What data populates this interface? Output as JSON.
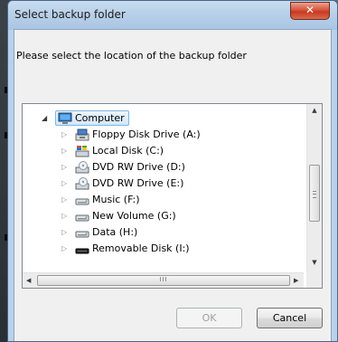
{
  "dialog": {
    "title": "Select backup folder",
    "close_glyph": "✕",
    "prompt": "Please select the location of the backup folder"
  },
  "tree": {
    "root": {
      "label": "Computer",
      "icon": "computer-icon",
      "expanded": true,
      "selected": true
    },
    "items": [
      {
        "label": "Floppy Disk Drive (A:)",
        "icon": "floppy-drive-icon"
      },
      {
        "label": "Local Disk (C:)",
        "icon": "system-disk-icon"
      },
      {
        "label": "DVD RW Drive (D:)",
        "icon": "dvd-drive-icon"
      },
      {
        "label": "DVD RW Drive (E:)",
        "icon": "dvd-drive-icon"
      },
      {
        "label": "Music (F:)",
        "icon": "hard-disk-icon"
      },
      {
        "label": "New Volume (G:)",
        "icon": "hard-disk-icon"
      },
      {
        "label": "Data (H:)",
        "icon": "hard-disk-icon"
      },
      {
        "label": "Removable Disk (I:)",
        "icon": "removable-disk-icon"
      }
    ],
    "hscroll_grip": "III"
  },
  "buttons": {
    "ok": {
      "label": "OK",
      "enabled": false
    },
    "cancel": {
      "label": "Cancel",
      "enabled": true
    }
  }
}
